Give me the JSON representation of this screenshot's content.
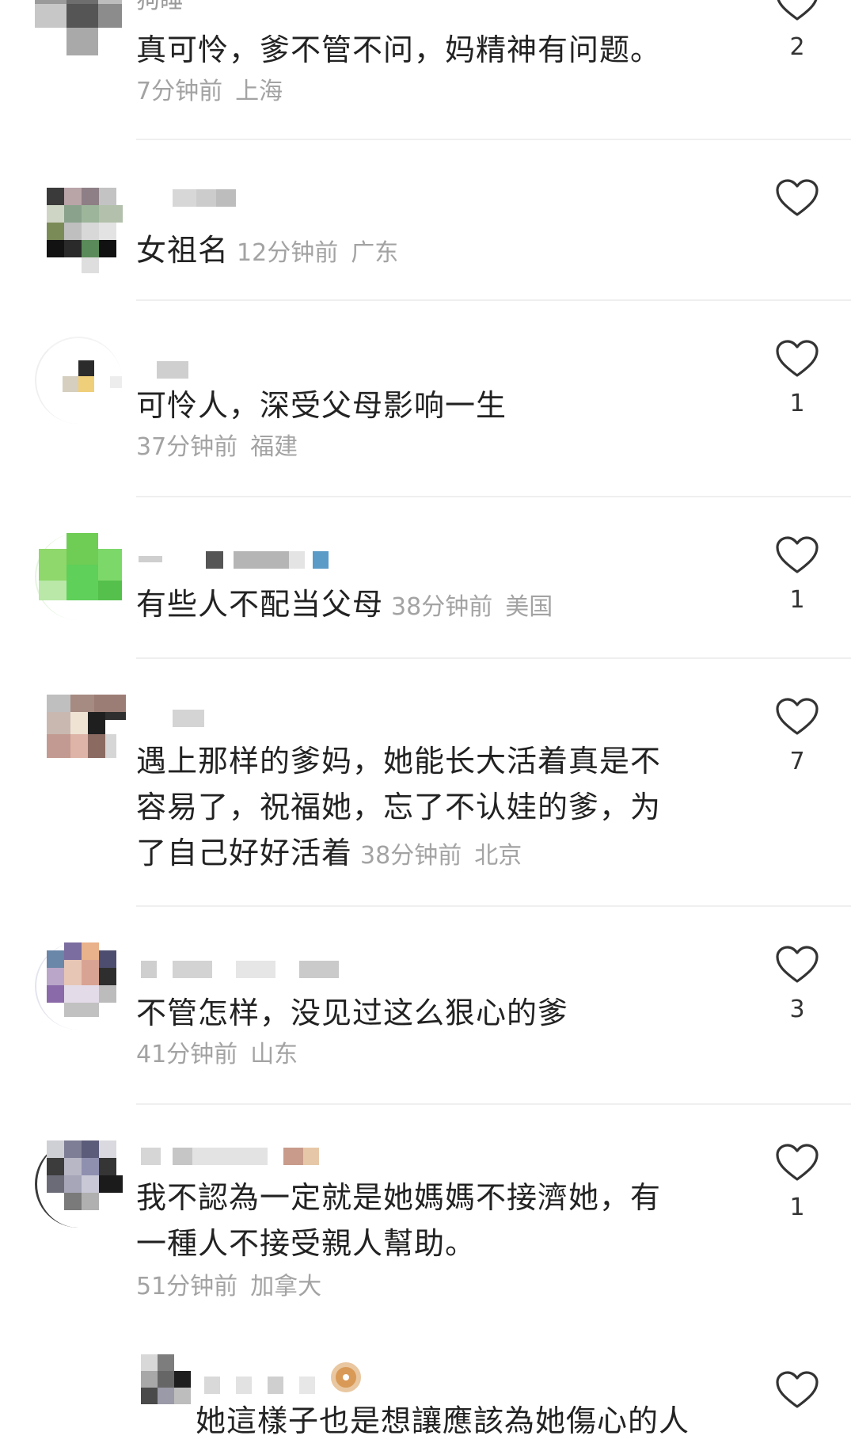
{
  "comments": [
    {
      "username": "狗睡",
      "text": "真可怜，爹不管不问，妈精神有问题。",
      "time": "7分钟前",
      "location": "上海",
      "likes": "2"
    },
    {
      "text": "女祖名",
      "time": "12分钟前",
      "location": "广东",
      "likes": ""
    },
    {
      "text": "可怜人，深受父母影响一生",
      "time": "37分钟前",
      "location": "福建",
      "likes": "1"
    },
    {
      "text": "有些人不配当父母",
      "time": "38分钟前",
      "location": "美国",
      "likes": "1"
    },
    {
      "text_line1": "遇上那样的爹妈，她能长大活着真是不",
      "text_line2": "容易了，祝福她，忘了不认娃的爹，为",
      "text_line3": "了自己好好活着",
      "time": "38分钟前",
      "location": "北京",
      "likes": "7"
    },
    {
      "text": "不管怎样，没见过这么狠心的爹",
      "time": "41分钟前",
      "location": "山东",
      "likes": "3"
    },
    {
      "text_line1": "我不認為一定就是她媽媽不接濟她，有",
      "text_line2": "一種人不接受親人幫助。",
      "time": "51分钟前",
      "location": "加拿大",
      "likes": "1"
    },
    {
      "text": "她這樣子也是想讓應該為她傷心的人",
      "likes": ""
    }
  ],
  "icons": {
    "like": "heart-outline-icon",
    "avatar": "avatar-pixelated"
  },
  "colors": {
    "text": "#222222",
    "meta": "#a3a3a3",
    "divider": "#efefef",
    "icon": "#333333"
  }
}
